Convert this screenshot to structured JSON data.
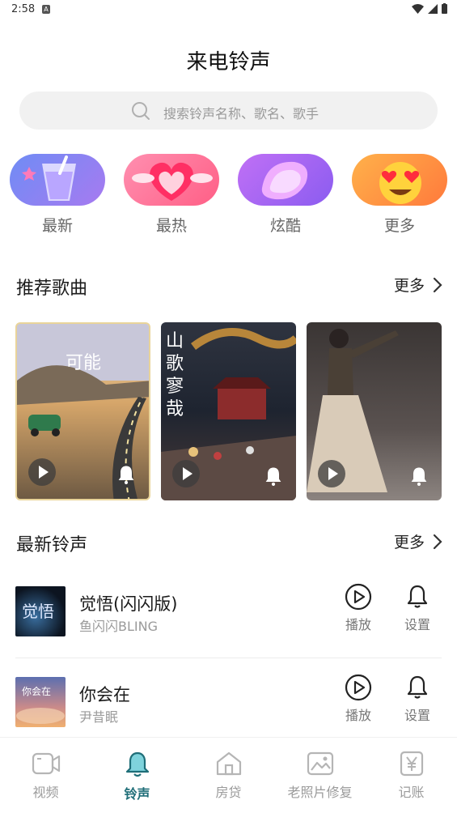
{
  "status": {
    "time": "2:58",
    "notif_badge": "A"
  },
  "header": {
    "title": "来电铃声"
  },
  "search": {
    "placeholder": "搜索铃声名称、歌名、歌手"
  },
  "categories": [
    {
      "label": "最新",
      "icon": "cup-icon",
      "color": "#8c7cf0"
    },
    {
      "label": "最热",
      "icon": "heart-icon",
      "color": "#ff6f94"
    },
    {
      "label": "炫酷",
      "icon": "gem-icon",
      "color": "#b56cf2"
    },
    {
      "label": "更多",
      "icon": "heart-eyes-emoji-icon",
      "color": "#ff9a3c"
    }
  ],
  "recommended": {
    "title": "推荐歌曲",
    "more": "更多",
    "cards": [
      {
        "name": "song-card-1",
        "cover_text": "可能"
      },
      {
        "name": "song-card-2",
        "cover_text": "山歌寥哉"
      },
      {
        "name": "song-card-3",
        "cover_text": ""
      }
    ]
  },
  "latest": {
    "title": "最新铃声",
    "more": "更多",
    "items": [
      {
        "title": "觉悟(闪闪版)",
        "artist": "鱼闪闪BLING",
        "play": "播放",
        "set": "设置"
      },
      {
        "title": "你会在",
        "artist": "尹昔眠",
        "play": "播放",
        "set": "设置"
      }
    ]
  },
  "nav": {
    "items": [
      {
        "label": "视频",
        "icon": "video-icon"
      },
      {
        "label": "铃声",
        "icon": "bell-icon",
        "active": true
      },
      {
        "label": "房贷",
        "icon": "house-icon"
      },
      {
        "label": "老照片修复",
        "icon": "photo-icon"
      },
      {
        "label": "记账",
        "icon": "yen-icon"
      }
    ]
  },
  "colors": {
    "accent": "#1f6e78",
    "muted": "#9b9b9b"
  }
}
